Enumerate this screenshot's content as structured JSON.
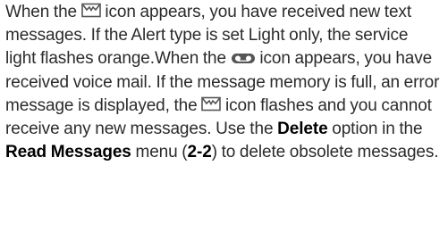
{
  "paragraph": {
    "s1_a": "When the",
    "s1_b": "icon appears, you have received new text messages. If the Alert type is set Light only, the service light flashes orange.When the",
    "s1_c": "icon appears, you have received voice mail. If the message memory is full, an error message is displayed, the",
    "s1_d": "icon flashes and you cannot receive any new messages. Use the",
    "bold_delete": "Delete",
    "s1_e": "option in the",
    "bold_read_messages": "Read Messages",
    "s1_f": "menu (",
    "bold_menu_code": "2-2",
    "s1_g": ") to delete obsolete messages."
  },
  "icons": {
    "message": "envelope-icon",
    "voicemail": "voicemail-icon"
  },
  "colors": {
    "text": "#2b2b2b",
    "bold_text": "#000000",
    "background": "#ffffff",
    "icon": "#555555"
  }
}
